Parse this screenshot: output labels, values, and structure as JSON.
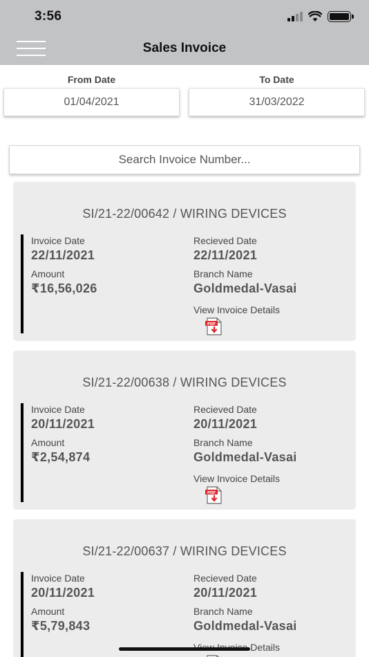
{
  "status_bar": {
    "time": "3:56"
  },
  "header": {
    "title": "Sales Invoice",
    "menu_icon": "hamburger-icon"
  },
  "filters": {
    "from_label": "From Date",
    "from_value": "01/04/2021",
    "to_label": "To Date",
    "to_value": "31/03/2022"
  },
  "search": {
    "placeholder": "Search Invoice Number..."
  },
  "labels": {
    "invoice_date": "Invoice Date",
    "received_date": "Recieved Date",
    "amount": "Amount",
    "branch_name": "Branch Name",
    "view_details": "View Invoice Details"
  },
  "invoices": [
    {
      "title": "SI/21-22/00642 / WIRING DEVICES",
      "invoice_date": "22/11/2021",
      "received_date": "22/11/2021",
      "amount": "₹16,56,026",
      "branch": "Goldmedal-Vasai"
    },
    {
      "title": "SI/21-22/00638 / WIRING DEVICES",
      "invoice_date": "20/11/2021",
      "received_date": "20/11/2021",
      "amount": "₹2,54,874",
      "branch": "Goldmedal-Vasai"
    },
    {
      "title": "SI/21-22/00637 / WIRING DEVICES",
      "invoice_date": "20/11/2021",
      "received_date": "20/11/2021",
      "amount": "₹5,79,843",
      "branch": "Goldmedal-Vasai"
    }
  ],
  "colors": {
    "header_bg": "#c2c3c5",
    "card_bg": "#ececec",
    "pdf_red": "#e0262a"
  }
}
